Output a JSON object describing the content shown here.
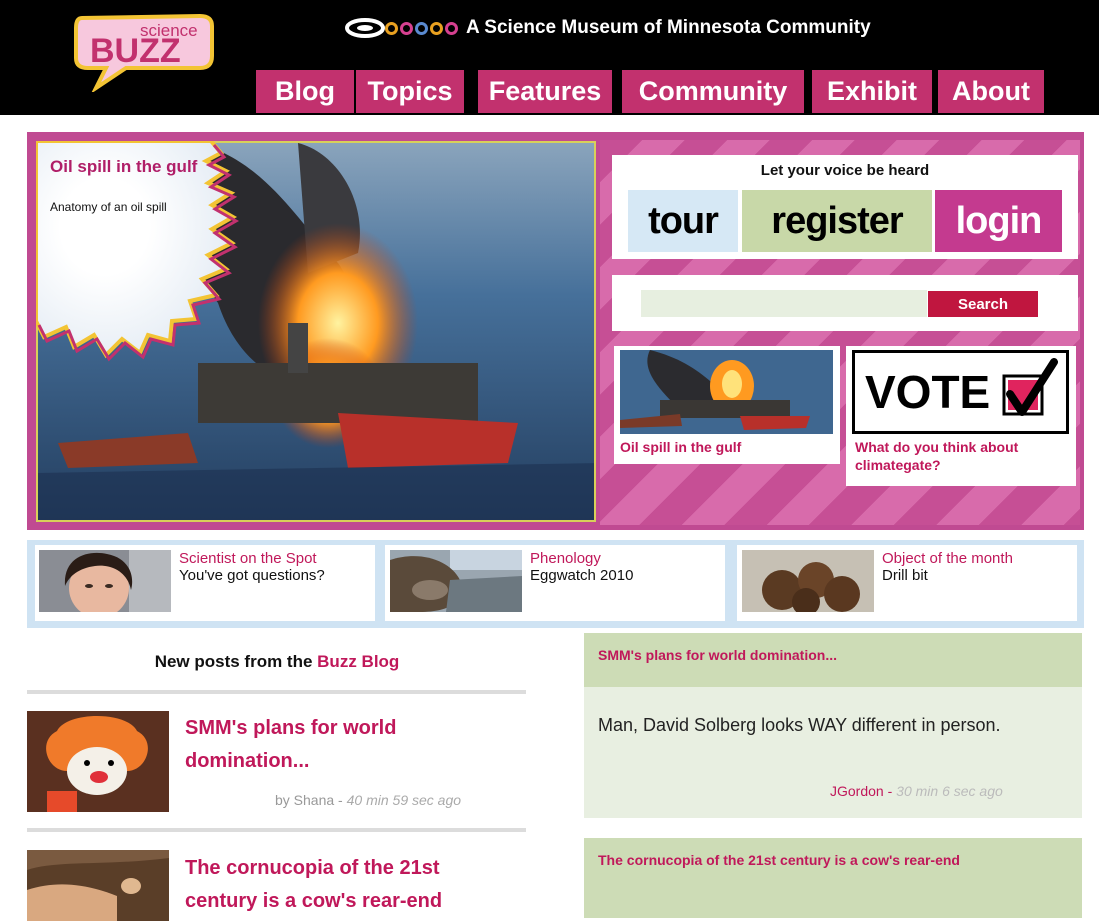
{
  "header": {
    "logo_top": "science",
    "logo_bottom": "BUZZ",
    "tagline": "A Science Museum of Minnesota Community",
    "nav": [
      "Blog",
      "Topics",
      "Features",
      "Community",
      "Exhibit",
      "About"
    ]
  },
  "feature": {
    "title": "Oil spill in the gulf",
    "subtitle": "Anatomy of an oil spill",
    "voice_title": "Let your voice be heard",
    "buttons": {
      "tour": "tour",
      "register": "register",
      "login": "login"
    },
    "search": {
      "placeholder": "",
      "button": "Search"
    },
    "thumb_label": "Oil spill in the gulf",
    "vote_word": "VOTE",
    "vote_label": "What do you think about climategate?"
  },
  "promos": [
    {
      "title": "Scientist on the Spot",
      "text": "You've got questions?"
    },
    {
      "title": "Phenology",
      "text": "Eggwatch 2010"
    },
    {
      "title": "Object of the month",
      "text": "Drill bit"
    }
  ],
  "blog": {
    "heading_prefix": "New posts from the ",
    "heading_highlight": "Buzz Blog",
    "posts": [
      {
        "title": "SMM's plans for world domination...",
        "by": "by Shana",
        "sep": " - ",
        "time": "40 min 59 sec ago"
      },
      {
        "title": "The cornucopia of the 21st century is a cow's rear-end"
      }
    ]
  },
  "comments": [
    {
      "title": "SMM's plans for world domination...",
      "text": "Man, David Solberg looks WAY different in person.",
      "author": "JGordon",
      "sep": " - ",
      "time": "30 min 6 sec ago"
    },
    {
      "title": "The cornucopia of the 21st century is a cow's rear-end"
    }
  ],
  "colors": {
    "accent": "#c0185a",
    "nav": "#c2316e",
    "feature_bg": "#c04a92",
    "promo_bg": "#cfe3f3",
    "comment_head": "#cddcb6"
  }
}
